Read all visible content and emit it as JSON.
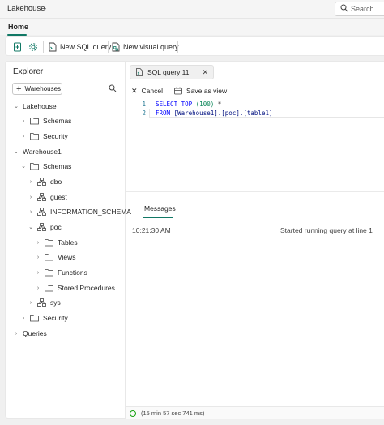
{
  "app": {
    "title": "Lakehouse"
  },
  "search": {
    "label": "Search"
  },
  "ribbon": {
    "tab_home": "Home"
  },
  "toolbar": {
    "new_sql_query": "New SQL query",
    "new_visual_query": "New visual query"
  },
  "explorer": {
    "title": "Explorer",
    "warehouses_button": "Warehouses",
    "tree": {
      "lakehouse": "Lakehouse",
      "lh_schemas": "Schemas",
      "lh_security": "Security",
      "warehouse1": "Warehouse1",
      "wh_schemas": "Schemas",
      "dbo": "dbo",
      "guest": "guest",
      "information_schema": "INFORMATION_SCHEMA",
      "poc": "poc",
      "tables": "Tables",
      "views": "Views",
      "functions": "Functions",
      "stored_procedures": "Stored Procedures",
      "sys": "sys",
      "wh_security": "Security",
      "queries": "Queries"
    }
  },
  "editor": {
    "tab_label": "SQL query 11",
    "cancel": "Cancel",
    "save_as_view": "Save as view",
    "lines": [
      {
        "number": "1",
        "kw1": "SELECT TOP ",
        "num": "(100)",
        "rest": " *"
      },
      {
        "number": "2",
        "kw1": "FROM ",
        "ident": "[Warehouse1].[poc].[table1]"
      }
    ]
  },
  "messages": {
    "tab": "Messages",
    "time": "10:21:30 AM",
    "text": "Started running query at line 1"
  },
  "status": {
    "elapsed": "(15 min 57 sec 741 ms)"
  },
  "colors": {
    "accent": "#117865",
    "sql_keyword": "#0000ff"
  }
}
